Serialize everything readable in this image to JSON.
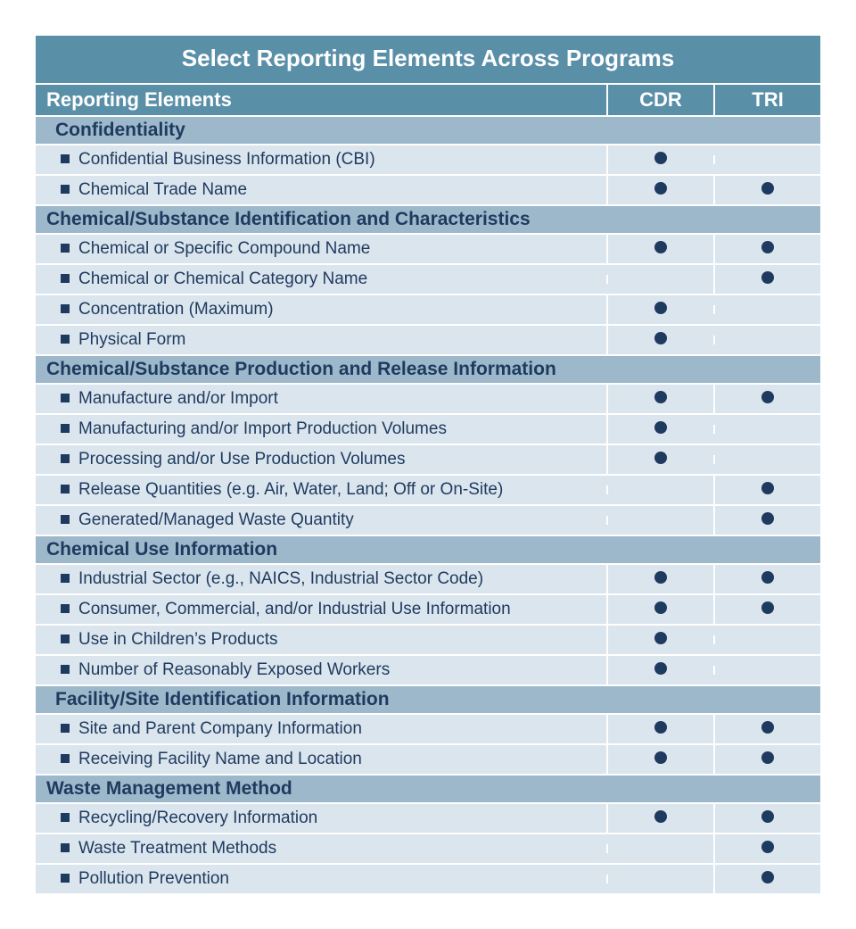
{
  "title": "Select Reporting Elements Across Programs",
  "columns": {
    "elements": "Reporting Elements",
    "cdr": "CDR",
    "tri": "TRI"
  },
  "sections": [
    {
      "name": "Confidentiality",
      "indent": true,
      "items": [
        {
          "label": "Confidential Business Information (CBI)",
          "cdr": true,
          "tri": false
        },
        {
          "label": "Chemical Trade Name",
          "cdr": true,
          "tri": true
        }
      ]
    },
    {
      "name": "Chemical/Substance Identification and Characteristics",
      "indent": false,
      "items": [
        {
          "label": "Chemical or Specific Compound Name",
          "cdr": true,
          "tri": true
        },
        {
          "label": "Chemical or Chemical Category Name",
          "cdr": false,
          "tri": true
        },
        {
          "label": "Concentration (Maximum)",
          "cdr": true,
          "tri": false
        },
        {
          "label": "Physical Form",
          "cdr": true,
          "tri": false
        }
      ]
    },
    {
      "name": "Chemical/Substance Production and Release Information",
      "indent": false,
      "items": [
        {
          "label": "Manufacture and/or Import",
          "cdr": true,
          "tri": true
        },
        {
          "label": "Manufacturing and/or Import Production Volumes",
          "cdr": true,
          "tri": false
        },
        {
          "label": "Processing and/or Use Production Volumes",
          "cdr": true,
          "tri": false
        },
        {
          "label": "Release Quantities (e.g. Air, Water, Land; Off or On-Site)",
          "cdr": false,
          "tri": true
        },
        {
          "label": "Generated/Managed Waste Quantity",
          "cdr": false,
          "tri": true
        }
      ]
    },
    {
      "name": "Chemical Use Information",
      "indent": false,
      "items": [
        {
          "label": "Industrial Sector (e.g., NAICS, Industrial Sector Code)",
          "cdr": true,
          "tri": true
        },
        {
          "label": "Consumer, Commercial, and/or Industrial Use Information",
          "cdr": true,
          "tri": true
        },
        {
          "label": "Use in Children’s Products",
          "cdr": true,
          "tri": false
        },
        {
          "label": "Number of Reasonably Exposed Workers",
          "cdr": true,
          "tri": false
        }
      ]
    },
    {
      "name": "Facility/Site Identification Information",
      "indent": true,
      "items": [
        {
          "label": "Site and Parent Company Information",
          "cdr": true,
          "tri": true
        },
        {
          "label": "Receiving Facility Name and Location",
          "cdr": true,
          "tri": true
        }
      ]
    },
    {
      "name": "Waste Management Method",
      "indent": false,
      "items": [
        {
          "label": "Recycling/Recovery Information",
          "cdr": true,
          "tri": true
        },
        {
          "label": "Waste Treatment Methods",
          "cdr": false,
          "tri": true
        },
        {
          "label": "Pollution Prevention",
          "cdr": false,
          "tri": true
        }
      ]
    }
  ]
}
